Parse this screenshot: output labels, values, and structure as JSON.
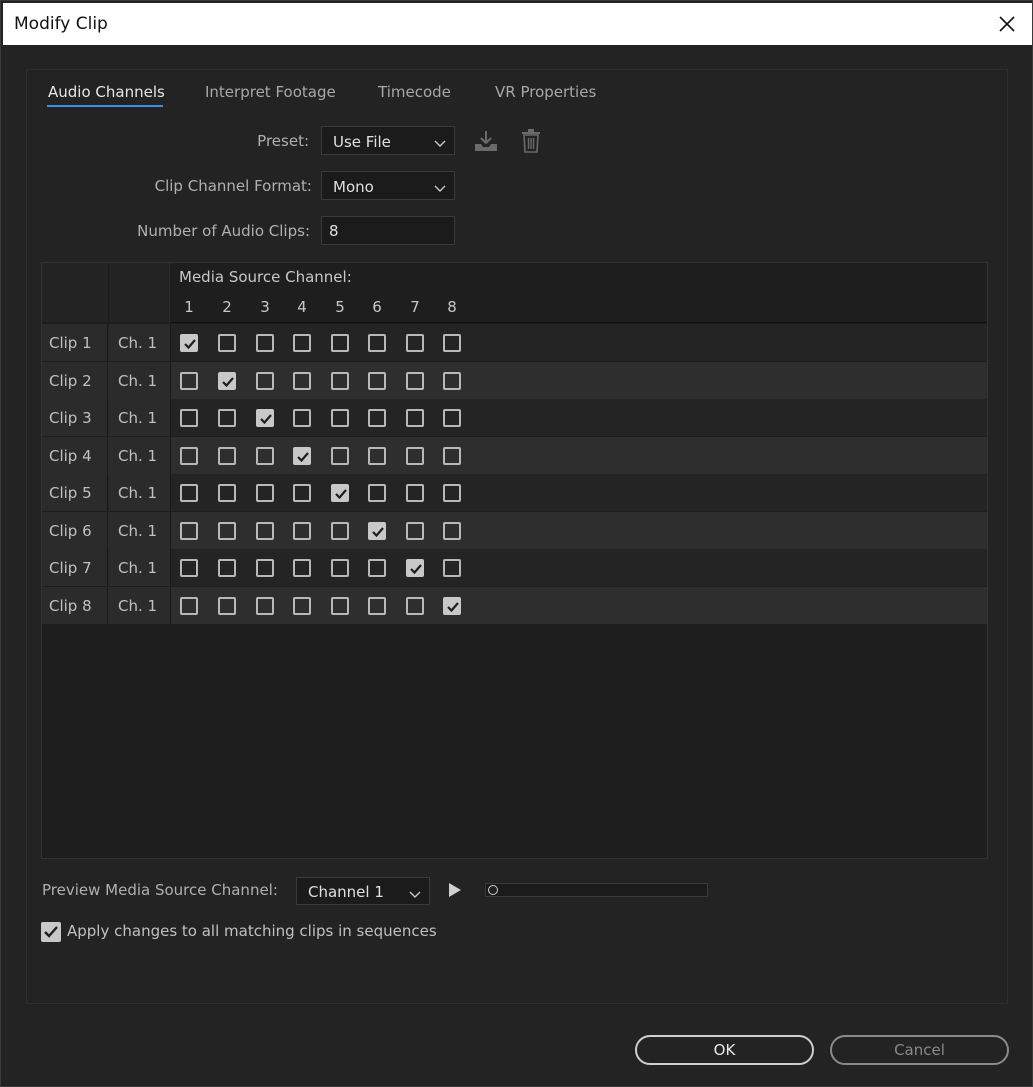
{
  "window": {
    "title": "Modify Clip"
  },
  "tabs": [
    {
      "label": "Audio Channels",
      "active": true
    },
    {
      "label": "Interpret Footage",
      "active": false
    },
    {
      "label": "Timecode",
      "active": false
    },
    {
      "label": "VR Properties",
      "active": false
    }
  ],
  "form": {
    "preset_label": "Preset:",
    "preset_value": "Use File",
    "format_label": "Clip Channel Format:",
    "format_value": "Mono",
    "num_clips_label": "Number of Audio Clips:",
    "num_clips_value": "8"
  },
  "icons": {
    "save_preset": "download-preset-icon",
    "delete_preset": "trash-icon",
    "close": "close-icon",
    "play": "play-icon"
  },
  "grid": {
    "media_label": "Media Source Channel:",
    "columns": [
      "1",
      "2",
      "3",
      "4",
      "5",
      "6",
      "7",
      "8"
    ],
    "rows": [
      {
        "clip": "Clip 1",
        "ch": "Ch. 1",
        "checked": [
          1,
          0,
          0,
          0,
          0,
          0,
          0,
          0
        ]
      },
      {
        "clip": "Clip 2",
        "ch": "Ch. 1",
        "checked": [
          0,
          1,
          0,
          0,
          0,
          0,
          0,
          0
        ]
      },
      {
        "clip": "Clip 3",
        "ch": "Ch. 1",
        "checked": [
          0,
          0,
          1,
          0,
          0,
          0,
          0,
          0
        ]
      },
      {
        "clip": "Clip 4",
        "ch": "Ch. 1",
        "checked": [
          0,
          0,
          0,
          1,
          0,
          0,
          0,
          0
        ]
      },
      {
        "clip": "Clip 5",
        "ch": "Ch. 1",
        "checked": [
          0,
          0,
          0,
          0,
          1,
          0,
          0,
          0
        ]
      },
      {
        "clip": "Clip 6",
        "ch": "Ch. 1",
        "checked": [
          0,
          0,
          0,
          0,
          0,
          1,
          0,
          0
        ]
      },
      {
        "clip": "Clip 7",
        "ch": "Ch. 1",
        "checked": [
          0,
          0,
          0,
          0,
          0,
          0,
          1,
          0
        ]
      },
      {
        "clip": "Clip 8",
        "ch": "Ch. 1",
        "checked": [
          0,
          0,
          0,
          0,
          0,
          0,
          0,
          1
        ]
      }
    ]
  },
  "preview": {
    "label": "Preview Media Source Channel:",
    "channel_value": "Channel 1",
    "progress": 0.0
  },
  "apply_all": {
    "label": "Apply changes to all matching clips in sequences",
    "checked": true
  },
  "buttons": {
    "ok": "OK",
    "cancel": "Cancel"
  },
  "colors": {
    "accent": "#3d8ee6",
    "background": "#232323"
  }
}
